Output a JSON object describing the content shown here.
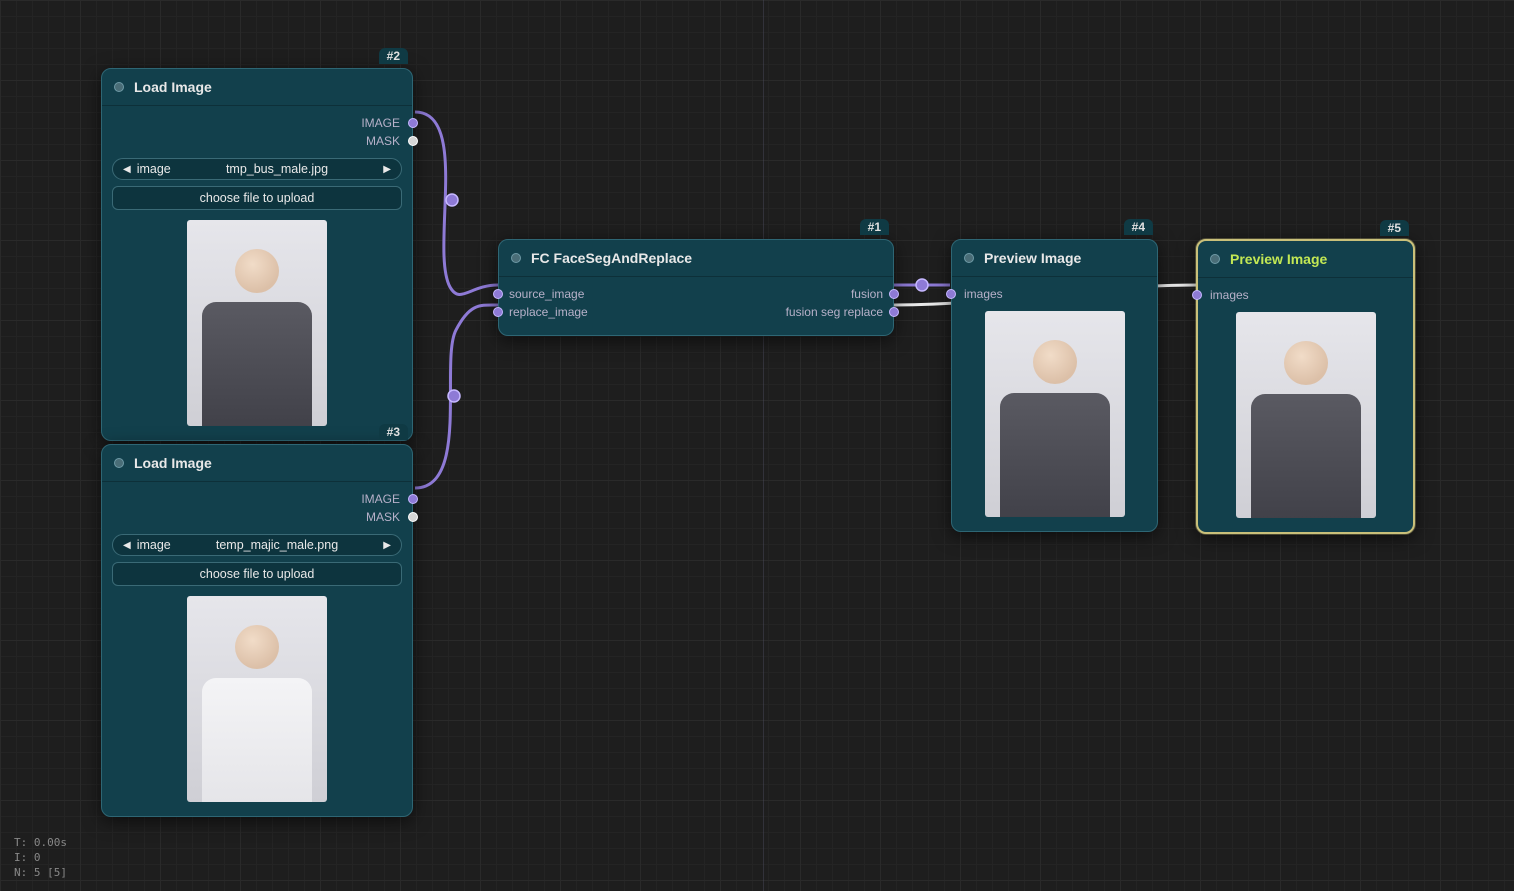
{
  "nodes": {
    "n2": {
      "badge": "#2",
      "title": "Load Image",
      "outputs": {
        "image": "IMAGE",
        "mask": "MASK"
      },
      "combo": {
        "label": "image",
        "value": "tmp_bus_male.jpg"
      },
      "upload_btn": "choose file to upload"
    },
    "n3": {
      "badge": "#3",
      "title": "Load Image",
      "outputs": {
        "image": "IMAGE",
        "mask": "MASK"
      },
      "combo": {
        "label": "image",
        "value": "temp_majic_male.png"
      },
      "upload_btn": "choose file to upload"
    },
    "n1": {
      "badge": "#1",
      "title": "FC FaceSegAndReplace",
      "inputs": {
        "source": "source_image",
        "replace": "replace_image"
      },
      "outputs": {
        "fusion": "fusion",
        "seg": "fusion seg replace"
      }
    },
    "n4": {
      "badge": "#4",
      "title": "Preview Image",
      "inputs": {
        "images": "images"
      }
    },
    "n5": {
      "badge": "#5",
      "title": "Preview Image",
      "inputs": {
        "images": "images"
      }
    }
  },
  "stats": {
    "t": "T: 0.00s",
    "i": "I: 0",
    "n": "N: 5 [5]"
  }
}
